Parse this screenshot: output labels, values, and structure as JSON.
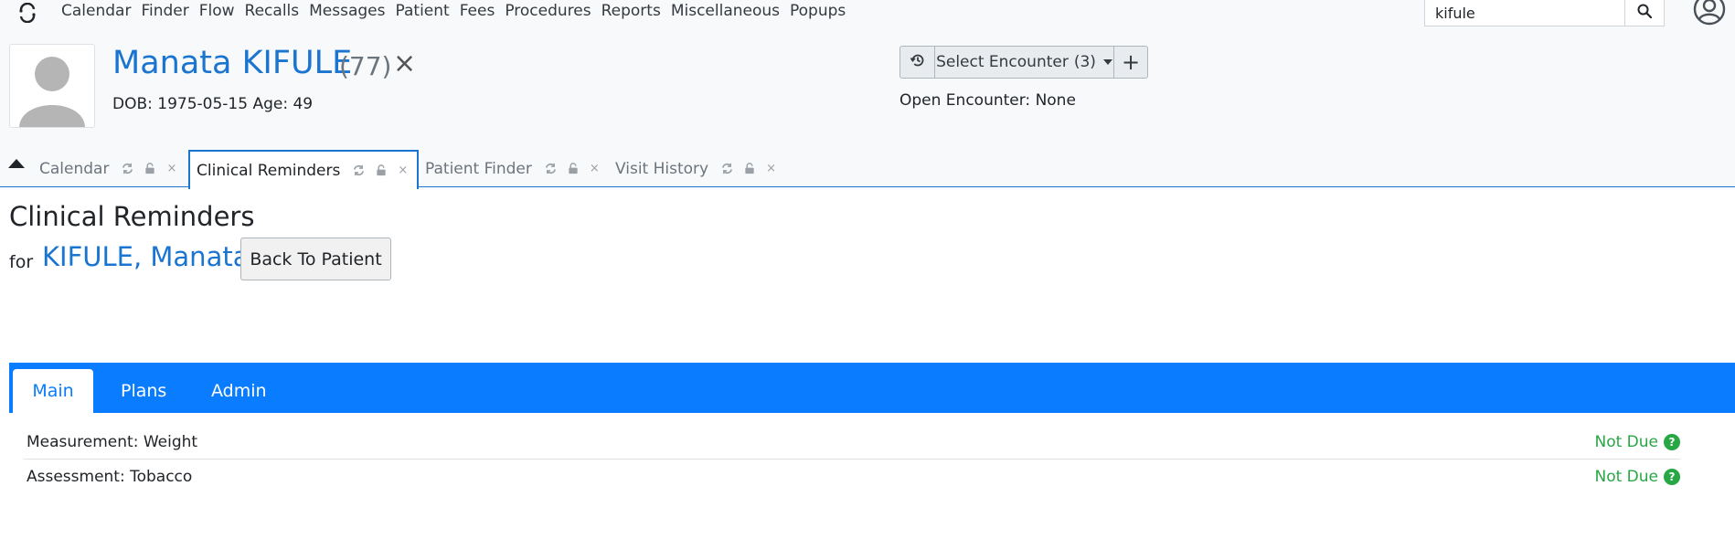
{
  "nav": {
    "menu": [
      "Calendar",
      "Finder",
      "Flow",
      "Recalls",
      "Messages",
      "Patient",
      "Fees",
      "Procedures",
      "Reports",
      "Miscellaneous",
      "Popups"
    ],
    "search_value": "kifule"
  },
  "patient": {
    "name": "Manata KIFULE",
    "number": "(77)",
    "close_symbol": "×",
    "dob_line": "DOB: 1975-05-15 Age: 49"
  },
  "encounter": {
    "select_label": "Select Encounter",
    "count": "(3)",
    "add_symbol": "+",
    "open_line": "Open Encounter: None"
  },
  "tabs": [
    {
      "label": "Calendar"
    },
    {
      "label": "Clinical Reminders"
    },
    {
      "label": "Patient Finder"
    },
    {
      "label": "Visit History"
    }
  ],
  "page": {
    "title": "Clinical Reminders",
    "for_label": "for",
    "for_name": "KIFULE, Manata",
    "back_button": "Back To Patient"
  },
  "sub_tabs": [
    "Main",
    "Plans",
    "Admin"
  ],
  "reminders": [
    {
      "name": "Measurement: Weight",
      "status": "Not Due"
    },
    {
      "name": "Assessment: Tobacco",
      "status": "Not Due"
    }
  ],
  "colors": {
    "accent": "#1a75d1",
    "tab_bar": "#0a7cff",
    "status_ok": "#28a745"
  }
}
